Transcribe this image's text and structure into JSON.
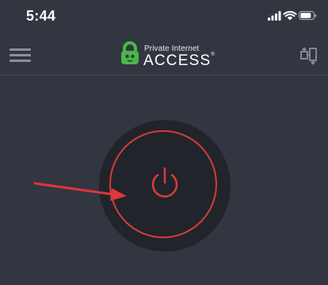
{
  "status_bar": {
    "time": "5:44"
  },
  "header": {
    "logo_line1": "Private Internet",
    "logo_line2": "ACCESS",
    "logo_mark": "®"
  },
  "colors": {
    "background": "#323640",
    "ring_dark": "#21242b",
    "power_red": "#d43c3c",
    "arrow_red": "#e0363a",
    "brand_green": "#4cb649"
  },
  "icons": {
    "menu": "hamburger-menu-icon",
    "region": "region-switch-icon",
    "power": "power-icon",
    "lock": "padlock-icon"
  }
}
